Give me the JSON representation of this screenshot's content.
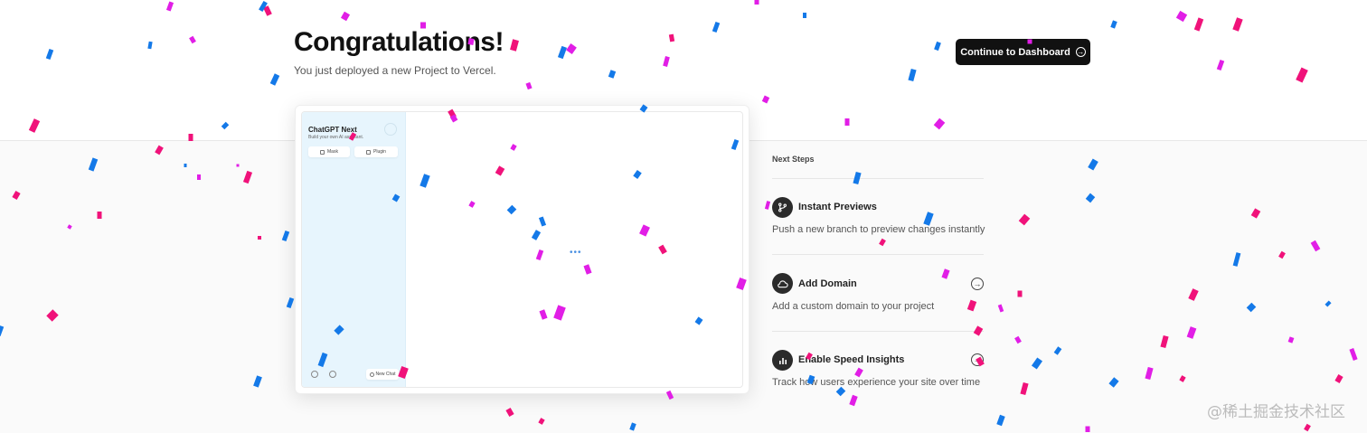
{
  "header": {
    "title": "Congratulations!",
    "subtitle": "You just deployed a new Project to Vercel.",
    "dashboard_button": "Continue to Dashboard"
  },
  "preview": {
    "app_title": "ChatGPT Next",
    "app_subtitle": "Build your own AI assistant.",
    "mask_button": "Mask",
    "plugin_button": "Plugin",
    "new_chat_button": "New Chat",
    "loading": "•••"
  },
  "next_steps": {
    "title": "Next Steps",
    "items": [
      {
        "title": "Instant Previews",
        "description": "Push a new branch to preview changes instantly",
        "icon": "git-branch-icon"
      },
      {
        "title": "Add Domain",
        "description": "Add a custom domain to your project",
        "icon": "cloud-icon"
      },
      {
        "title": "Enable Speed Insights",
        "description": "Track how users experience your site over time",
        "icon": "bar-chart-icon"
      }
    ]
  },
  "watermark": "@稀土掘金技术社区",
  "colors": {
    "confetti_pink": "#f0127a",
    "confetti_magenta": "#e11ee6",
    "confetti_blue": "#1479e8",
    "button_dark": "#111111"
  }
}
